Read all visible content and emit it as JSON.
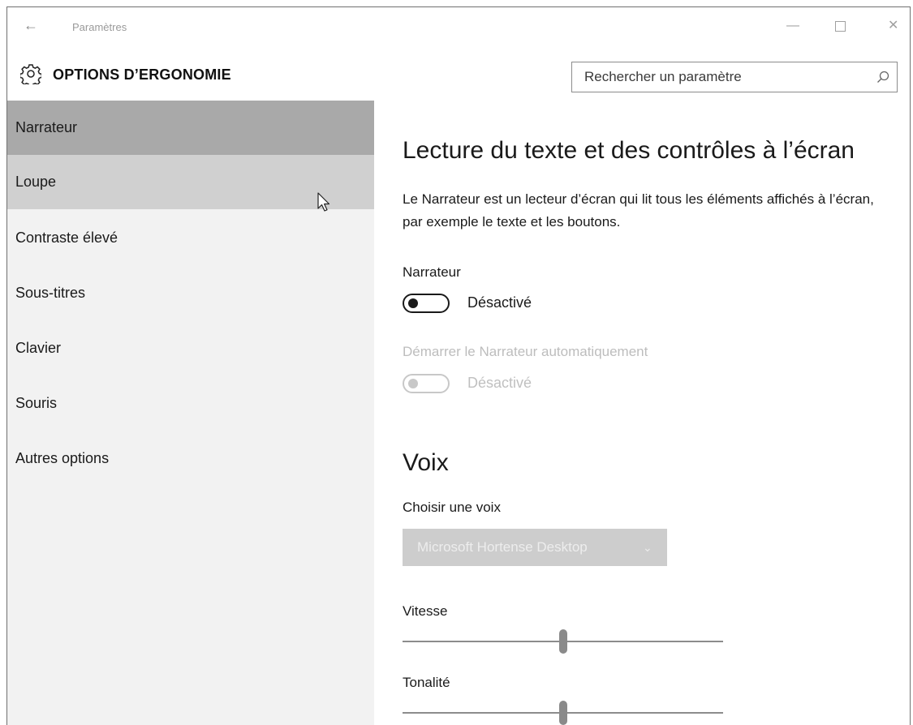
{
  "window": {
    "title": "Paramètres",
    "back_icon": "arrow-left-icon",
    "controls": [
      "minimize-icon",
      "maximize-icon",
      "close-icon"
    ]
  },
  "header": {
    "icon": "gear-icon",
    "title": "OPTIONS D’ERGONOMIE",
    "search": {
      "placeholder": "Rechercher un paramètre",
      "value": "",
      "icon": "search-icon"
    }
  },
  "sidebar": {
    "selected_bg": "#a9a9a9",
    "hover_bg": "#d0d0d0",
    "items": [
      {
        "label": "Narrateur",
        "state": "selected"
      },
      {
        "label": "Loupe",
        "state": "hover"
      },
      {
        "label": "Contraste élevé",
        "state": ""
      },
      {
        "label": "Sous-titres",
        "state": ""
      },
      {
        "label": "Clavier",
        "state": ""
      },
      {
        "label": "Souris",
        "state": ""
      },
      {
        "label": "Autres options",
        "state": ""
      }
    ]
  },
  "content": {
    "heading": "Lecture du texte et des contrôles à l’écran",
    "description": "Le Narrateur est un lecteur d’écran qui lit tous les éléments affichés à l’écran, par exemple le texte et les boutons.",
    "narrator": {
      "label": "Narrateur",
      "toggle_state": "Désactivé",
      "on": false
    },
    "auto_start": {
      "label": "Démarrer le Narrateur automatiquement",
      "toggle_state": "Désactivé",
      "on": false,
      "enabled": false
    },
    "voice_heading": "Voix",
    "voice_select": {
      "label": "Choisir une voix",
      "value": "Microsoft Hortense Desktop",
      "enabled": false
    },
    "speed": {
      "label": "Vitesse",
      "level_percent": 50
    },
    "pitch": {
      "label": "Tonalité",
      "level_percent": 50
    }
  }
}
